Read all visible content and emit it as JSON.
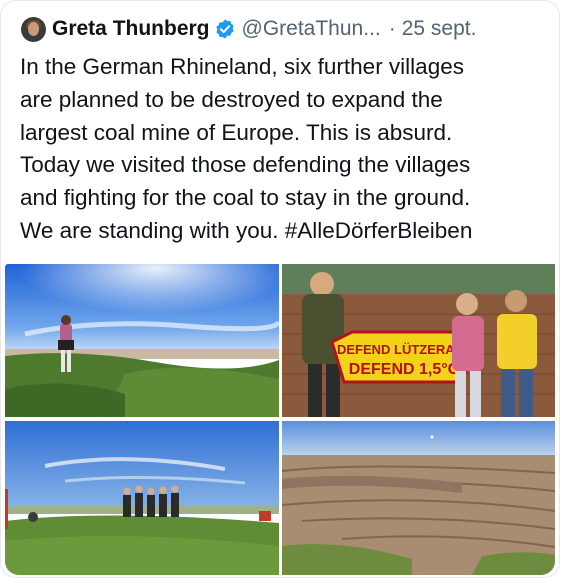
{
  "tweet": {
    "author_name": "Greta Thunberg",
    "author_handle": "@GretaThun...",
    "separator": "·",
    "date": "25 sept.",
    "verified": true,
    "text": "In the German Rhineland, six further villages\nare planned to be destroyed to expand the\nlargest coal mine of Europe. This is absurd.\nToday we visited those defending the villages\nand fighting for the coal to stay in the ground.\nWe are standing with you. #AlleDörferBleiben",
    "hashtag": "#AlleDörferBleiben"
  },
  "photos": [
    {
      "name": "photo-field-landscape"
    },
    {
      "name": "photo-protest-sign",
      "sign_line1": "DEFEND LÜTZERATH",
      "sign_line2": "DEFEND 1,5°C"
    },
    {
      "name": "photo-group-on-hill"
    },
    {
      "name": "photo-open-pit-mine"
    }
  ],
  "colors": {
    "text": "#0f1419",
    "secondary": "#536471",
    "verified": "#1d9bf0",
    "border": "#e5e8eb"
  }
}
